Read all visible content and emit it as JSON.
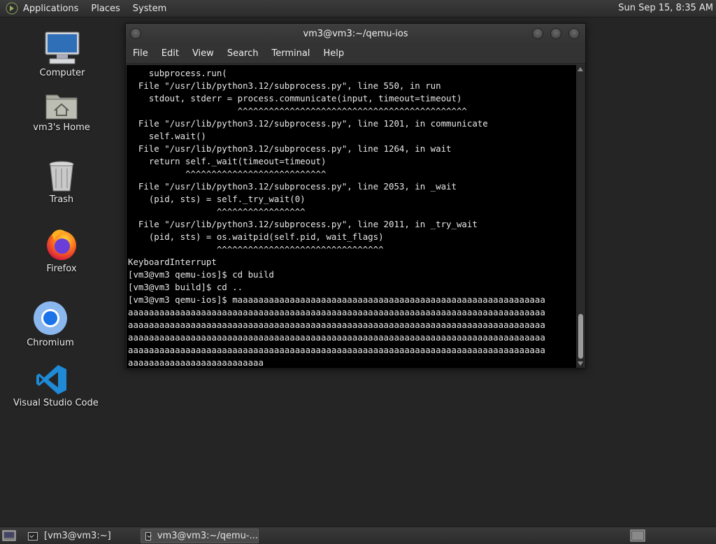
{
  "top_panel": {
    "menus": [
      "Applications",
      "Places",
      "System"
    ],
    "clock": "Sun Sep 15,  8:35 AM"
  },
  "desktop_icons": [
    {
      "label": "Computer",
      "icon": "computer-icon"
    },
    {
      "label": "vm3's Home",
      "icon": "home-folder-icon"
    },
    {
      "label": "Trash",
      "icon": "trash-icon"
    },
    {
      "label": "Firefox",
      "icon": "firefox-icon"
    },
    {
      "label": "Chromium",
      "icon": "chromium-icon"
    },
    {
      "label": "Visual Studio Code",
      "icon": "vscode-icon"
    }
  ],
  "terminal": {
    "title": "vm3@vm3:~/qemu-ios",
    "menu": [
      "File",
      "Edit",
      "View",
      "Search",
      "Terminal",
      "Help"
    ],
    "lines": [
      "    subprocess.run(",
      "  File \"/usr/lib/python3.12/subprocess.py\", line 550, in run",
      "    stdout, stderr = process.communicate(input, timeout=timeout)",
      "                     ^^^^^^^^^^^^^^^^^^^^^^^^^^^^^^^^^^^^^^^^^^^^",
      "  File \"/usr/lib/python3.12/subprocess.py\", line 1201, in communicate",
      "    self.wait()",
      "  File \"/usr/lib/python3.12/subprocess.py\", line 1264, in wait",
      "    return self._wait(timeout=timeout)",
      "           ^^^^^^^^^^^^^^^^^^^^^^^^^^^",
      "  File \"/usr/lib/python3.12/subprocess.py\", line 2053, in _wait",
      "    (pid, sts) = self._try_wait(0)",
      "                 ^^^^^^^^^^^^^^^^^",
      "  File \"/usr/lib/python3.12/subprocess.py\", line 2011, in _try_wait",
      "    (pid, sts) = os.waitpid(self.pid, wait_flags)",
      "                 ^^^^^^^^^^^^^^^^^^^^^^^^^^^^^^^^",
      "KeyboardInterrupt",
      "[vm3@vm3 qemu-ios]$ cd build",
      "[vm3@vm3 build]$ cd ..",
      "[vm3@vm3 qemu-ios]$ maaaaaaaaaaaaaaaaaaaaaaaaaaaaaaaaaaaaaaaaaaaaaaaaaaaaaaaaaaa",
      "aaaaaaaaaaaaaaaaaaaaaaaaaaaaaaaaaaaaaaaaaaaaaaaaaaaaaaaaaaaaaaaaaaaaaaaaaaaaaaaa",
      "aaaaaaaaaaaaaaaaaaaaaaaaaaaaaaaaaaaaaaaaaaaaaaaaaaaaaaaaaaaaaaaaaaaaaaaaaaaaaaaa",
      "aaaaaaaaaaaaaaaaaaaaaaaaaaaaaaaaaaaaaaaaaaaaaaaaaaaaaaaaaaaaaaaaaaaaaaaaaaaaaaaa",
      "aaaaaaaaaaaaaaaaaaaaaaaaaaaaaaaaaaaaaaaaaaaaaaaaaaaaaaaaaaaaaaaaaaaaaaaaaaaaaaaa",
      "aaaaaaaaaaaaaaaaaaaaaaaaaa"
    ]
  },
  "taskbar": {
    "tasks": [
      "[vm3@vm3:~]",
      "vm3@vm3:~/qemu-..."
    ]
  }
}
